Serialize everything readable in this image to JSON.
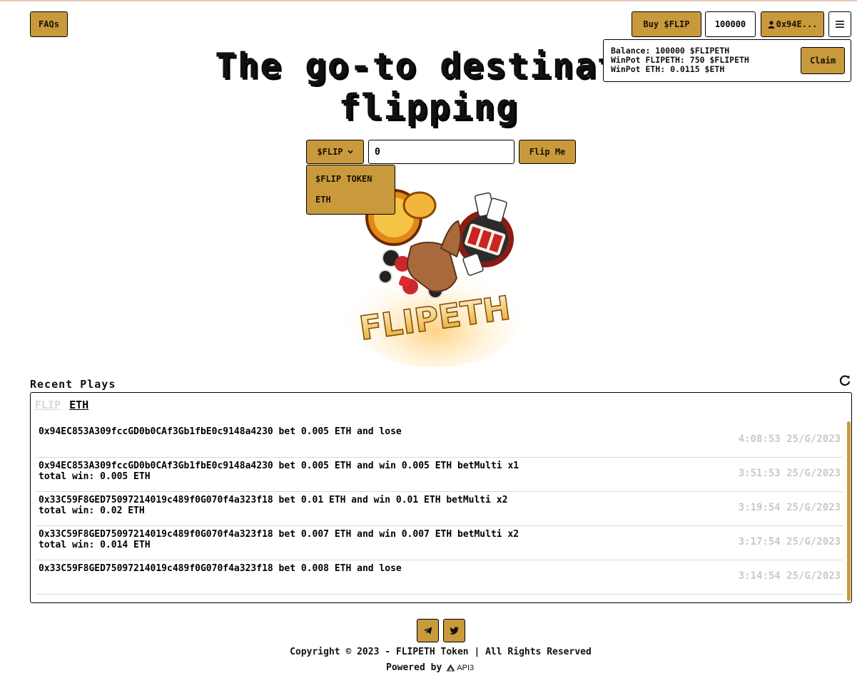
{
  "header": {
    "faq_label": "FAQs",
    "buy_label": "Buy $FLIP",
    "balance_value": "100000",
    "account_label": "0x94E...",
    "account_icon": "user-icon",
    "menu_icon": "hamburger-icon"
  },
  "wallet_popover": {
    "lines": [
      "Balance: 100000 $FLIPETH",
      "WinPot FLIPETH: 750 $FLIPETH",
      "WinPot ETH: 0.0115 $ETH"
    ],
    "claim_label": "Claim"
  },
  "hero": {
    "line1": "The go-to destinati",
    "line2": "flipping"
  },
  "bet_form": {
    "token_selected": "$FLIP",
    "amount_value": "0",
    "flip_label": "Flip Me",
    "token_options": [
      "$FLIP TOKEN",
      "ETH"
    ]
  },
  "logo": {
    "text": "FLIPETH",
    "alt": "FLIPETH casino logo"
  },
  "recent": {
    "title": "Recent Plays",
    "tabs": [
      "FLIP",
      "ETH"
    ],
    "active_tab": "ETH",
    "rows": [
      {
        "text": "0x94EC853A309fccGD0b0CAf3Gb1fbE0c9148a4230 bet 0.005 ETH and lose",
        "time": "4:08:53 25/G/2023"
      },
      {
        "text": "0x94EC853A309fccGD0b0CAf3Gb1fbE0c9148a4230 bet 0.005 ETH and win 0.005 ETH betMulti x1 total win: 0.005 ETH",
        "time": "3:51:53 25/G/2023"
      },
      {
        "text": "0x33C59F8GED75097214019c489f0G070f4a323f18 bet 0.01 ETH and win 0.01 ETH betMulti x2 total win: 0.02 ETH",
        "time": "3:19:54 25/G/2023"
      },
      {
        "text": "0x33C59F8GED75097214019c489f0G070f4a323f18 bet 0.007 ETH and win 0.007 ETH betMulti x2 total win: 0.014 ETH",
        "time": "3:17:54 25/G/2023"
      },
      {
        "text": "0x33C59F8GED75097214019c489f0G070f4a323f18 bet 0.008 ETH and lose",
        "time": "3:14:54 25/G/2023"
      }
    ]
  },
  "footer": {
    "copyright": "Copyright © 2023 - FLIPETH Token | All Rights Reserved",
    "powered_by": "Powered by",
    "api3": "API3",
    "social_icons": [
      "telegram-icon",
      "twitter-icon"
    ]
  },
  "colors": {
    "accent": "#c99a3c",
    "border": "#000000",
    "muted_time": "#c9c9c9"
  }
}
